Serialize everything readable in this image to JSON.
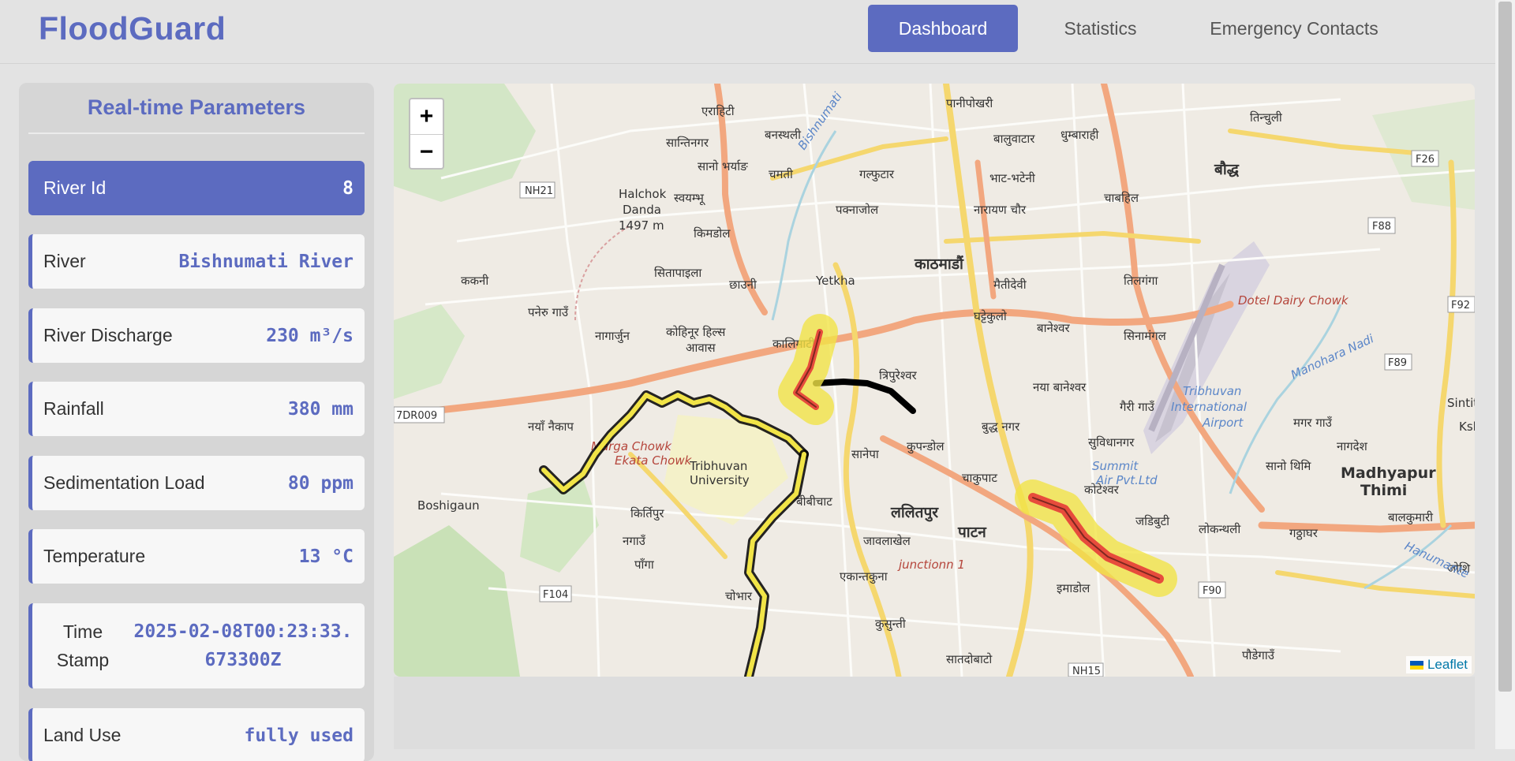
{
  "app": {
    "brand": "FloodGuard",
    "accent_color": "#5c6bc0"
  },
  "nav": {
    "items": [
      {
        "label": "Dashboard",
        "active": true
      },
      {
        "label": "Statistics",
        "active": false
      },
      {
        "label": "Emergency Contacts",
        "active": false
      }
    ]
  },
  "sidebar": {
    "title": "Real-time Parameters",
    "params": [
      {
        "label": "River Id",
        "value": "8",
        "highlight": true
      },
      {
        "label": "River",
        "value": "Bishnumati River"
      },
      {
        "label": "River Discharge",
        "value": "230 m³/s"
      },
      {
        "label": "Rainfall",
        "value": "380 mm"
      },
      {
        "label": "Sedimentation Load",
        "value": "80 ppm"
      },
      {
        "label": "Temperature",
        "value": "13 °C"
      },
      {
        "label": "Time Stamp",
        "value": "2025-02-08T00:23:33.673300Z"
      },
      {
        "label": "Land Use",
        "value": "fully used"
      }
    ]
  },
  "map": {
    "zoom_in": "+",
    "zoom_out": "−",
    "attribution": "Leaflet",
    "risk_colors": {
      "high": "#e74c3c",
      "medium": "#f1e447",
      "outline": "#000000"
    },
    "labels": {
      "kathmandu": "काठमाडौं",
      "lalitpur": "ललितपुर",
      "yetkha": "Yetkha",
      "halchok": "Halchok Danda 1497 m",
      "boshigaun": "Boshigaun",
      "madhyapur": "Madhyapur Thimi",
      "tribhuvan_airport": "Tribhuvan International Airport",
      "tribhuvan_university": "Tribhuvan University",
      "dotel": "Dotel Dairy Chowk",
      "summit": "Summit Air Pvt.Ltd",
      "junction": "junctionn 1",
      "ekata": "Ekata Chowk",
      "marga": "Marga Chowk",
      "sinti": "Sinti",
      "ksl": "Ksl",
      "bishnumati": "Bishnumati",
      "manohara": "Manohara Nadi",
      "hanumante": "Hanumante"
    },
    "shields": [
      "NH21",
      "F26",
      "F88",
      "F92",
      "F89",
      "F104",
      "F90",
      "NH15",
      "7DR009"
    ],
    "places": [
      "एराहिटी",
      "सान्तिनगर",
      "बनस्थली",
      "पानीपोखरी",
      "बालुवाटार",
      "धुम्बाराही",
      "तिन्चुली",
      "बौद्ध",
      "चाबहिल",
      "सानो भर्याङ",
      "चमती",
      "गल्फुटार",
      "स्वयम्भू",
      "किमडोल",
      "पक्नाजोल",
      "नारायण चौर",
      "भाट-भटेनी",
      "सितापाइला",
      "छाउनी",
      "मैतीदेवी",
      "तिलगंगा",
      "ककनी",
      "पनेरु गाउँ",
      "नागार्जुन",
      "कोहिनूर हिल्स आवास",
      "कालिमाटी",
      "घट्टेकुलो",
      "बानेश्वर",
      "सिनामंगल",
      "त्रिपुरेश्वर",
      "नया बानेश्वर",
      "गैरी गाउँ",
      "नयाँ नैकाप",
      "बुद्ध नगर",
      "सुविधानगर",
      "मगर गाउँ",
      "नागदेश",
      "सानेपा",
      "कुपन्डोल",
      "चाकुपाट",
      "सानो थिमि",
      "कोटेश्वर",
      "किर्तिपुर",
      "बीबीचाट",
      "जडिबुटी",
      "लोकन्थली",
      "गठ्ठाघर",
      "बालकुमारी",
      "नगाउँ",
      "जावलाखेल",
      "पाटन",
      "पाँगा",
      "एकान्तकुना",
      "इमाडोल",
      "जोशि",
      "चोभार",
      "कुसुन्ती",
      "सातदोबाटो",
      "पौडेगाउँ"
    ]
  }
}
